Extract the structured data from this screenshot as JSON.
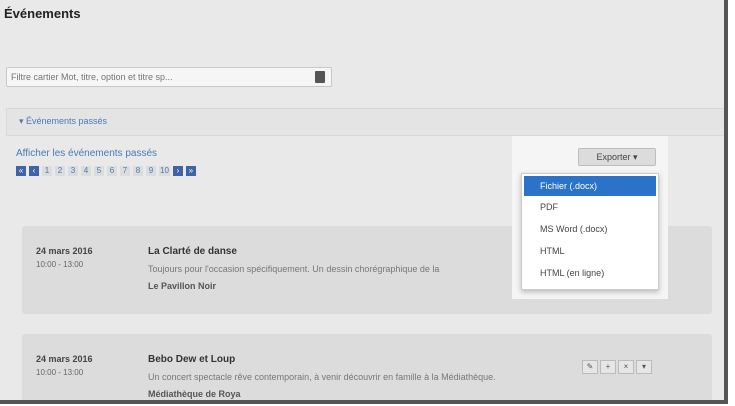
{
  "page": {
    "title": "Événements"
  },
  "search": {
    "placeholder": "Filtre cartier Mot, titre, option et titre sp..."
  },
  "past_panel": {
    "toggle_label": "▾ Événements passés"
  },
  "past_link": "Afficher les événements passés",
  "pagination": {
    "items": [
      "«",
      "‹",
      "1",
      "2",
      "3",
      "4",
      "5",
      "6",
      "7",
      "8",
      "9",
      "10",
      "›",
      "»"
    ]
  },
  "export": {
    "button_label": "Exporter ▾",
    "options": [
      "Fichier (.docx)",
      "PDF",
      "MS Word (.docx)",
      "HTML",
      "HTML (en ligne)"
    ],
    "selected_index": 0
  },
  "events": [
    {
      "date": "24 mars 2016",
      "time": "10:00 - 13:00",
      "title": "La Clarté de danse",
      "description": "Toujours pour l'occasion spécifiquement. Un dessin chorégraphique de la",
      "venue": "Le Pavillon Noir"
    },
    {
      "date": "24 mars 2016",
      "time": "10:00 - 13:00",
      "title": "Bebo Dew et Loup",
      "description": "Un concert spectacle rêve contemporain, à venir découvrir en famille à la Médiathèque.",
      "venue": "Médiathèque de Roya",
      "actions": [
        "✎",
        "+",
        "×",
        "▾"
      ]
    }
  ]
}
